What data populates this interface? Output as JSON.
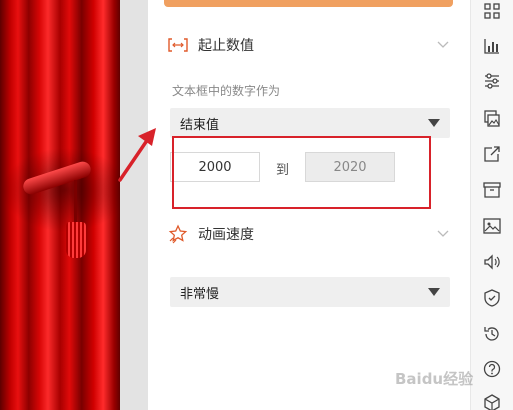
{
  "panel": {
    "range_section": {
      "title": "起止数值"
    },
    "number_label": "文本框中的数字作为",
    "mode_select": {
      "value": "结束值"
    },
    "range": {
      "start": "2000",
      "separator": "到",
      "end": "2020"
    },
    "speed_section": {
      "title": "动画速度"
    },
    "speed_select": {
      "value": "非常慢"
    }
  },
  "toolbar": {
    "items": [
      "apps-icon",
      "bar-chart-icon",
      "sliders-icon",
      "image-gallery-icon",
      "share-icon",
      "archive-icon",
      "image-icon",
      "volume-icon",
      "shield-icon",
      "history-icon",
      "help-icon",
      "cube-icon"
    ]
  },
  "watermark": "Baidu经验",
  "colors": {
    "accent": "#e05a2b",
    "highlight": "#d8222a",
    "top_bar": "#f0a060"
  }
}
